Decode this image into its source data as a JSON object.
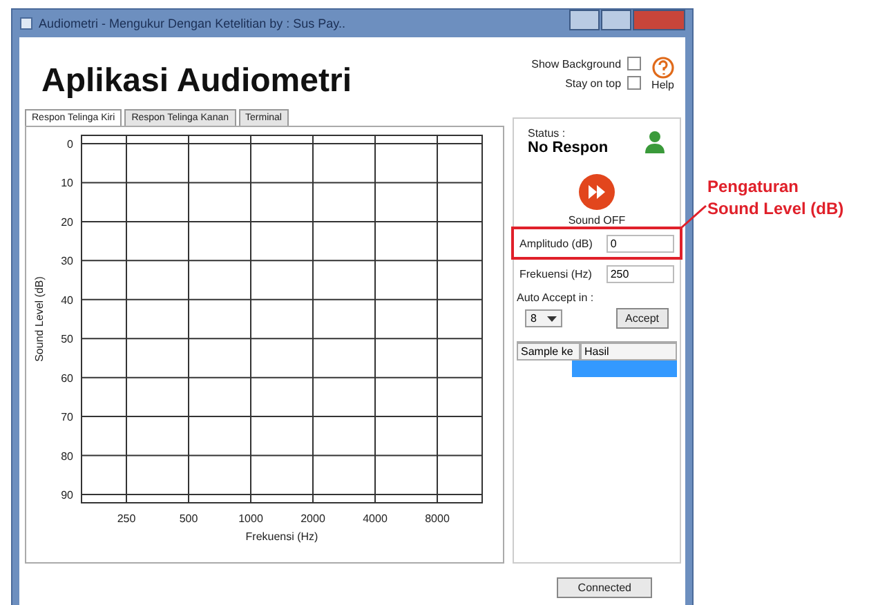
{
  "window": {
    "title": "Audiometri - Mengukur Dengan Ketelitian by : Sus Pay.."
  },
  "header": {
    "title": "Aplikasi Audiometri",
    "options": [
      {
        "label": "Show Background",
        "checked": false
      },
      {
        "label": "Stay on top",
        "checked": false
      }
    ],
    "help": "Help"
  },
  "tabs": [
    {
      "label": "Respon Telinga Kiri",
      "selected": true
    },
    {
      "label": "Respon Telinga Kanan",
      "selected": false
    },
    {
      "label": "Terminal",
      "selected": false
    }
  ],
  "chart": {
    "chart_data": {
      "type": "line",
      "xlabel": "Frekuensi (Hz)",
      "ylabel": "Sound Level (dB)",
      "categories": [
        "250",
        "500",
        "1000",
        "2000",
        "4000",
        "8000"
      ],
      "yticks": [
        0,
        10,
        20,
        30,
        40,
        50,
        60,
        70,
        80,
        90
      ],
      "ylim": [
        90,
        0
      ],
      "grid": true
    }
  },
  "panel": {
    "status_label": "Status :",
    "status": "No Respon",
    "sound": "Sound OFF",
    "fields": [
      {
        "label": "Amplitudo (dB)",
        "value": "0"
      },
      {
        "label": "Frekuensi (Hz)",
        "value": "250"
      }
    ],
    "auto_accept": {
      "label": "Auto Accept in :",
      "value": "8",
      "button": "Accept"
    },
    "table": {
      "columns": [
        "Sample ke",
        "Hasil"
      ],
      "rows": [
        {
          "selected": true
        }
      ]
    }
  },
  "status_button": "Connected",
  "annotation": {
    "text": "Pengaturan Sound Level (dB)"
  }
}
